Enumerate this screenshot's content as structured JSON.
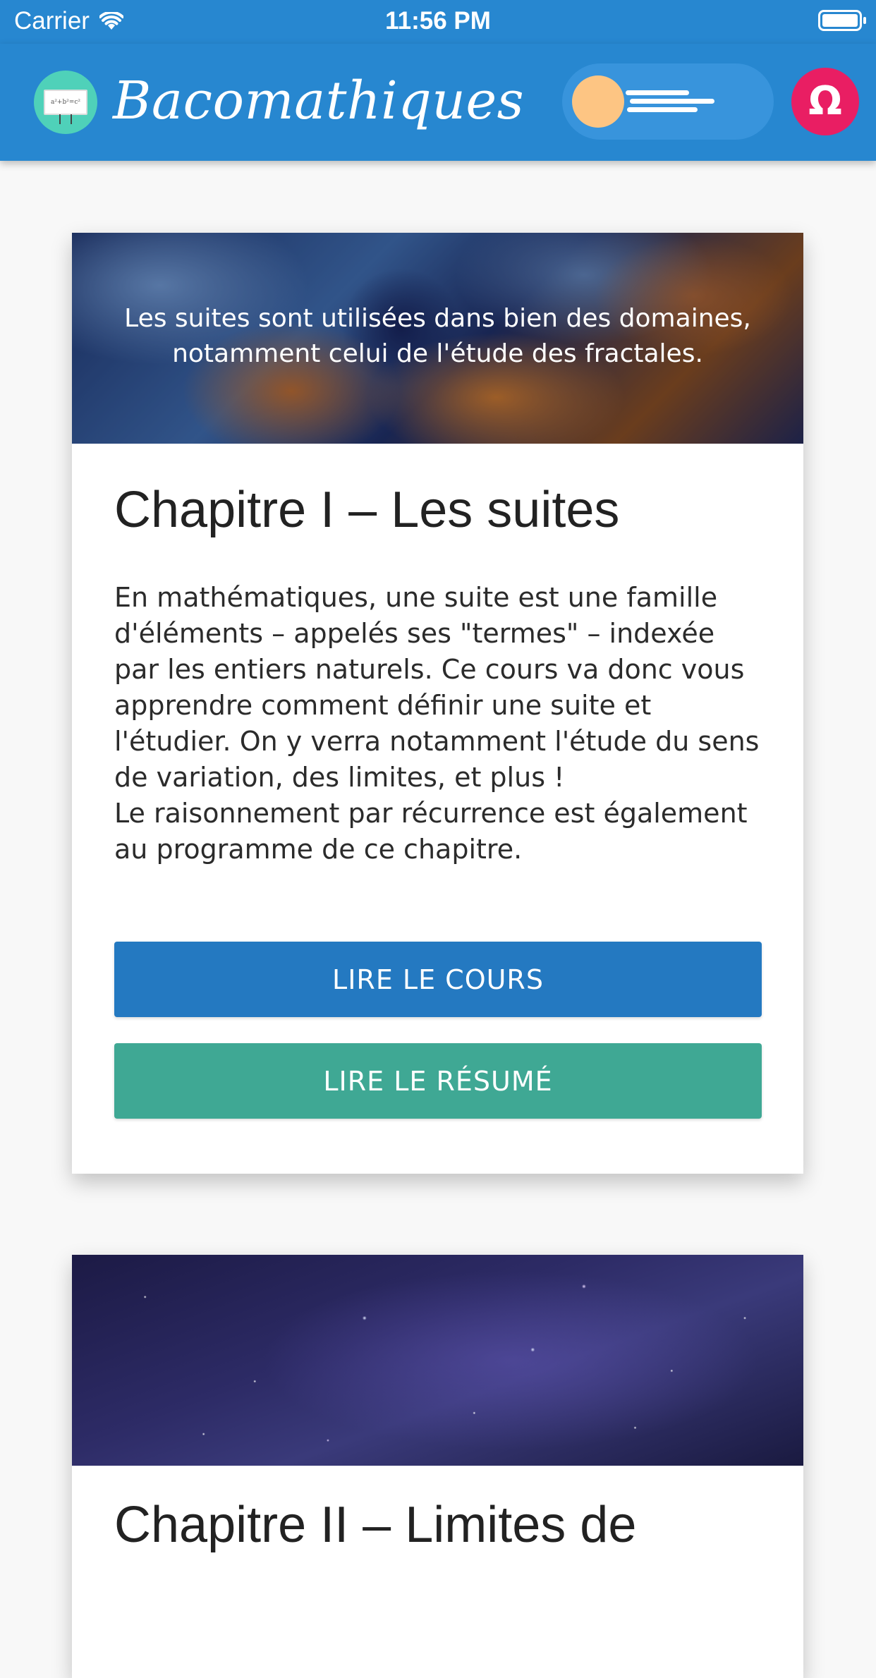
{
  "status_bar": {
    "carrier": "Carrier",
    "time": "11:56 PM"
  },
  "app_bar": {
    "title": "Bacomathiques",
    "logo_text": "a²+b²=c²",
    "accent_color": "#2787d0",
    "omega_symbol": "Ω",
    "omega_color": "#e91e63"
  },
  "chapters": [
    {
      "banner_caption": "Les suites sont utilisées dans bien des domaines,\nnotamment celui de l'étude des fractales.",
      "title": "Chapitre I – Les suites",
      "description": "En mathématiques, une suite est une famille d'éléments – appelés ses \"termes\" – indexée par les entiers naturels. Ce cours va donc vous apprendre comment définir une suite et l'étudier. On y verra notamment l'étude du sens de variation, des limites, et plus !\nLe raisonnement par récurrence est également au programme de ce chapitre.",
      "course_button": "LIRE LE COURS",
      "summary_button": "LIRE LE RÉSUMÉ"
    },
    {
      "title": "Chapitre II – Limites de"
    }
  ]
}
